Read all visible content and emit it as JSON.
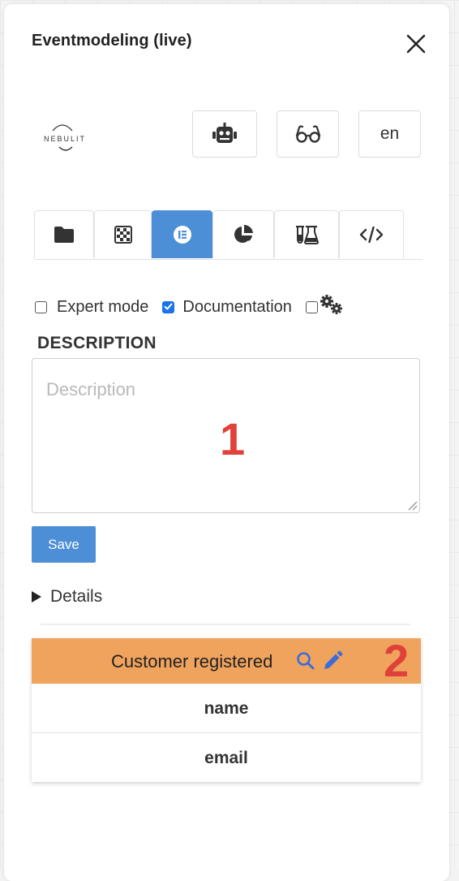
{
  "panel": {
    "title": "Eventmodeling (live)"
  },
  "logo": {
    "text": "NEBULIT"
  },
  "toolbar": {
    "ai_icon": "robot-icon",
    "view_icon": "glasses-icon",
    "language": "en"
  },
  "tabs": [
    {
      "icon": "folder-icon",
      "active": false
    },
    {
      "icon": "checkerboard-icon",
      "active": false
    },
    {
      "icon": "elementor-icon",
      "active": true
    },
    {
      "icon": "pie-chart-icon",
      "active": false
    },
    {
      "icon": "flask-icon",
      "active": false
    },
    {
      "icon": "code-icon",
      "active": false
    }
  ],
  "options": {
    "expert_mode": {
      "label": "Expert mode",
      "checked": false
    },
    "documentation": {
      "label": "Documentation",
      "checked": true
    },
    "settings": {
      "icon": "gears-icon",
      "checked": false
    }
  },
  "description": {
    "heading": "DESCRIPTION",
    "placeholder": "Description",
    "value": ""
  },
  "save_label": "Save",
  "details_label": "Details",
  "event_card": {
    "title": "Customer registered",
    "search_icon": "search-icon",
    "edit_icon": "pencil-icon",
    "fields": [
      "name",
      "email"
    ]
  },
  "annotations": [
    "1",
    "2"
  ],
  "colors": {
    "accent": "#4d8fd6",
    "event": "#f0a35d",
    "annotation": "#e0413a",
    "icon_blue": "#3d6bd9"
  }
}
